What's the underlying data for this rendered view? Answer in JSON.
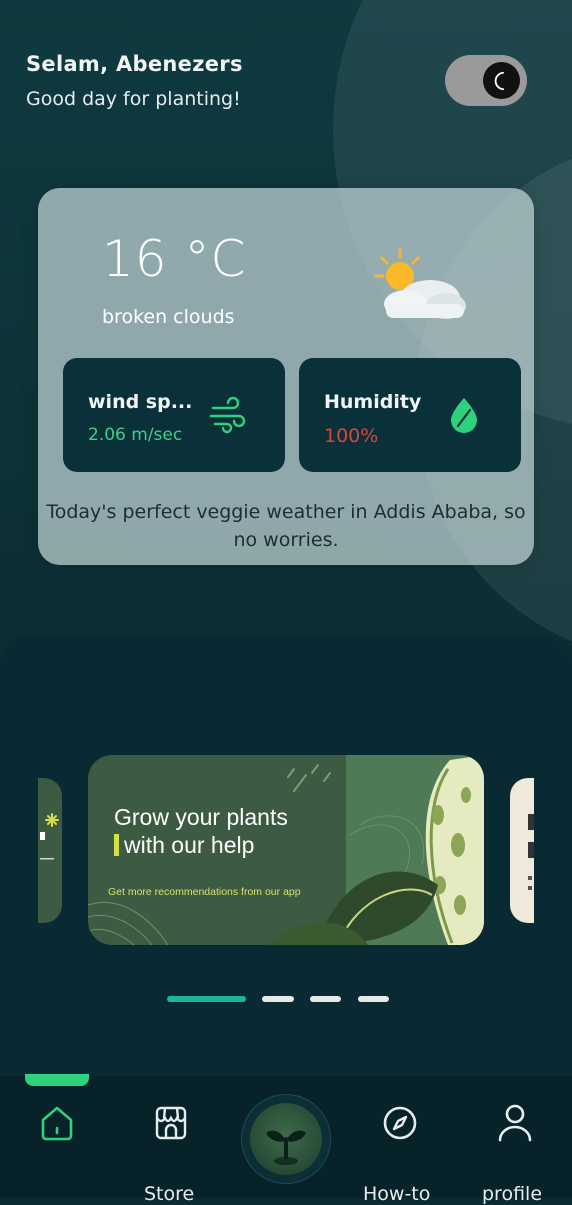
{
  "header": {
    "greeting": "Selam, Abenezers",
    "subtitle": "Good day for planting!"
  },
  "theme_toggle": {
    "state": "dark",
    "icon": "moon-icon"
  },
  "weather": {
    "temperature": "16 °C",
    "condition": "broken clouds",
    "icon": "sun-cloud-icon",
    "wind": {
      "label": "wind sp...",
      "value": "2.06 m/sec",
      "icon": "wind-icon"
    },
    "humidity": {
      "label": "Humidity",
      "value": "100%",
      "icon": "droplet-icon"
    },
    "message": "Today's perfect veggie weather in Addis Ababa, so no worries."
  },
  "carousel": {
    "banner": {
      "title_line1": "Grow your plants",
      "title_line2": "with our help",
      "subtitle": "Get more recommendations from our app"
    },
    "slide_count": 4,
    "active_index": 0
  },
  "colors": {
    "accent_green": "#2ed17e",
    "humidity_red": "#d6463f",
    "active_dot": "#1fb59a"
  },
  "nav": {
    "items": [
      {
        "label": "",
        "icon": "home-icon"
      },
      {
        "label": "Store",
        "icon": "store-icon"
      },
      {
        "label": "",
        "icon": "plant-scan-icon"
      },
      {
        "label": "How-to",
        "icon": "compass-icon"
      },
      {
        "label": "profile",
        "icon": "user-icon"
      }
    ]
  }
}
